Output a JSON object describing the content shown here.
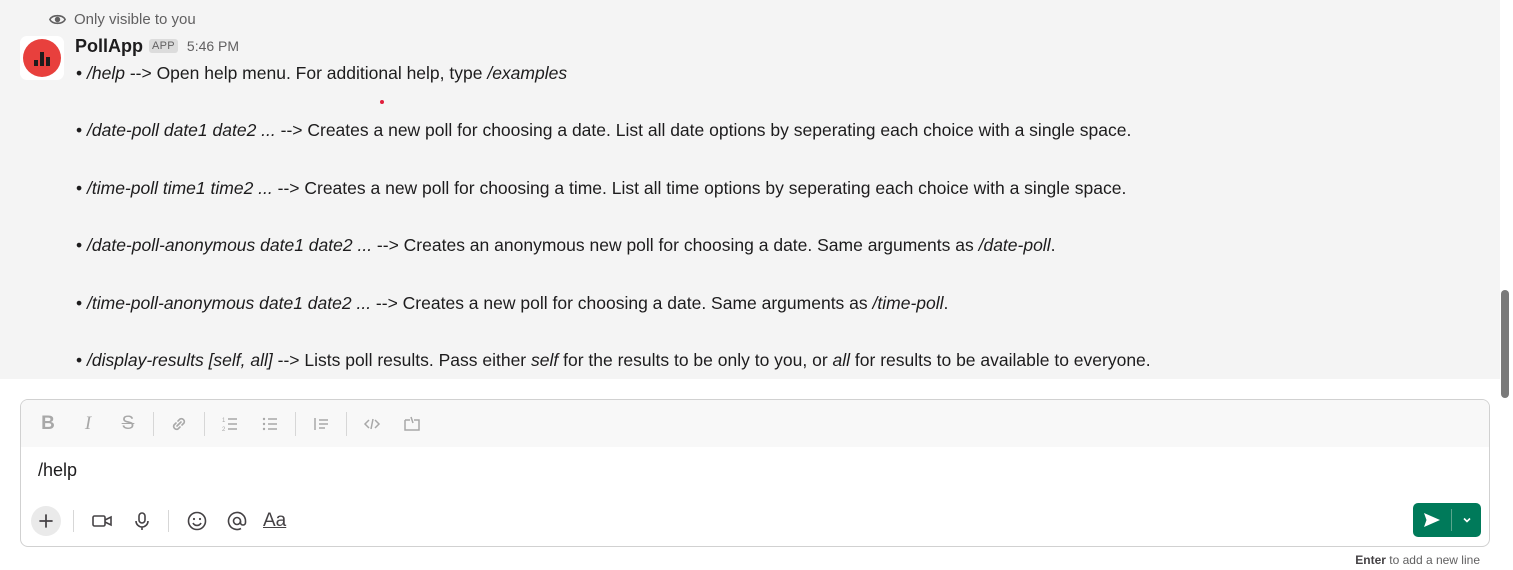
{
  "message": {
    "visibility_note": "Only visible to you",
    "app_name": "PollApp",
    "badge": "APP",
    "time": "5:46 PM",
    "lines": [
      {
        "cmd": "/help",
        "sep": " --> ",
        "text": "Open help menu. For additional help, type ",
        "tail_em": "/examples",
        "tail": ""
      },
      {
        "cmd": "/date-poll date1 date2 ...",
        "sep": " --> ",
        "text": "Creates a new poll for choosing a date. List all date options by seperating each choice with a single space.",
        "tail_em": "",
        "tail": ""
      },
      {
        "cmd": "/time-poll time1 time2 ...",
        "sep": " --> ",
        "text": "Creates a new poll for choosing a time. List all time options by seperating each choice with a single space.",
        "tail_em": "",
        "tail": ""
      },
      {
        "cmd": "/date-poll-anonymous date1 date2 ...",
        "sep": " --> ",
        "text": "Creates an anonymous new poll for choosing a date. Same arguments as ",
        "tail_em": "/date-poll",
        "tail": "."
      },
      {
        "cmd": "/time-poll-anonymous date1 date2 ...",
        "sep": " --> ",
        "text": "Creates a new poll for choosing a date. Same arguments as ",
        "tail_em": "/time-poll",
        "tail": "."
      },
      {
        "cmd": "/display-results [self, all]",
        "sep": " --> ",
        "text": "Lists poll results. Pass either ",
        "em2": "self",
        "text2": " for the results to be only to you, or ",
        "em3": "all",
        "text3": " for results to be available to everyone."
      }
    ]
  },
  "composer": {
    "input_value": "/help",
    "format_tools": [
      "bold-icon",
      "italic-icon",
      "strikethrough-icon",
      "link-icon",
      "ordered-list-icon",
      "bulleted-list-icon",
      "blockquote-icon",
      "code-icon",
      "code-block-icon"
    ],
    "bottom_tools": [
      "plus-icon",
      "video-icon",
      "microphone-icon",
      "emoji-icon",
      "mention-icon",
      "formatting-icon"
    ],
    "aa_label": "Aa",
    "send_color": "#007a5a",
    "hint_key": "Enter",
    "hint_text": " to add a new line"
  },
  "colors": {
    "avatar_bg": "#e8403d",
    "message_bg": "#f4f4f4"
  }
}
